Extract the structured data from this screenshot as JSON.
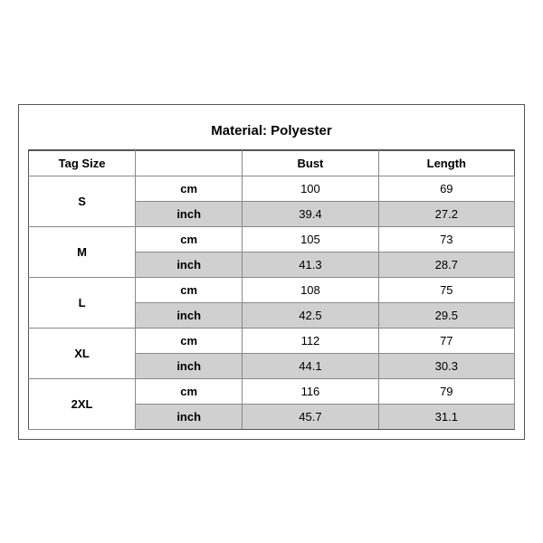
{
  "title": "Material: Polyester",
  "headers": {
    "tagSize": "Tag Size",
    "bust": "Bust",
    "length": "Length"
  },
  "sizes": [
    {
      "tag": "S",
      "rows": [
        {
          "unit": "cm",
          "bust": "100",
          "length": "69",
          "shaded": false
        },
        {
          "unit": "inch",
          "bust": "39.4",
          "length": "27.2",
          "shaded": true
        }
      ]
    },
    {
      "tag": "M",
      "rows": [
        {
          "unit": "cm",
          "bust": "105",
          "length": "73",
          "shaded": false
        },
        {
          "unit": "inch",
          "bust": "41.3",
          "length": "28.7",
          "shaded": true
        }
      ]
    },
    {
      "tag": "L",
      "rows": [
        {
          "unit": "cm",
          "bust": "108",
          "length": "75",
          "shaded": false
        },
        {
          "unit": "inch",
          "bust": "42.5",
          "length": "29.5",
          "shaded": true
        }
      ]
    },
    {
      "tag": "XL",
      "rows": [
        {
          "unit": "cm",
          "bust": "112",
          "length": "77",
          "shaded": false
        },
        {
          "unit": "inch",
          "bust": "44.1",
          "length": "30.3",
          "shaded": true
        }
      ]
    },
    {
      "tag": "2XL",
      "rows": [
        {
          "unit": "cm",
          "bust": "116",
          "length": "79",
          "shaded": false
        },
        {
          "unit": "inch",
          "bust": "45.7",
          "length": "31.1",
          "shaded": true
        }
      ]
    }
  ]
}
